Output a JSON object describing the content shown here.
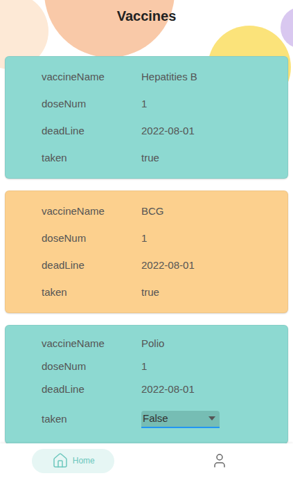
{
  "header": {
    "title": "Vaccines"
  },
  "cards": [
    {
      "color": "#8dd9d1",
      "fields": [
        {
          "label": "vaccineName",
          "value": "Hepatities B",
          "kind": "text"
        },
        {
          "label": "doseNum",
          "value": "1",
          "kind": "text"
        },
        {
          "label": "deadLine",
          "value": "2022-08-01",
          "kind": "text"
        },
        {
          "label": "taken",
          "value": "true",
          "kind": "text"
        }
      ]
    },
    {
      "color": "#fcd08e",
      "fields": [
        {
          "label": "vaccineName",
          "value": "BCG",
          "kind": "text"
        },
        {
          "label": "doseNum",
          "value": "1",
          "kind": "text"
        },
        {
          "label": "deadLine",
          "value": "2022-08-01",
          "kind": "text"
        },
        {
          "label": "taken",
          "value": "true",
          "kind": "text"
        }
      ]
    },
    {
      "color": "#8dd9d1",
      "fields": [
        {
          "label": "vaccineName",
          "value": "Polio",
          "kind": "text"
        },
        {
          "label": "doseNum",
          "value": "1",
          "kind": "text"
        },
        {
          "label": "deadLine",
          "value": "2022-08-01",
          "kind": "text"
        },
        {
          "label": "taken",
          "value": "False",
          "kind": "select"
        }
      ]
    }
  ],
  "nav": {
    "items": [
      {
        "label": "Home",
        "kind": "home",
        "selected": true
      },
      {
        "label": "",
        "kind": "profile",
        "selected": false
      }
    ]
  }
}
